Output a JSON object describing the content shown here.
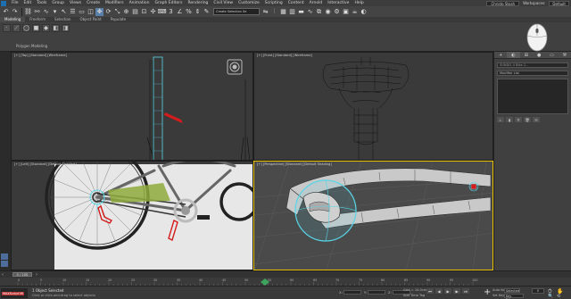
{
  "menu": {
    "items": [
      "File",
      "Edit",
      "Tools",
      "Group",
      "Views",
      "Create",
      "Modifiers",
      "Animation",
      "Graph Editors",
      "Rendering",
      "Civil View",
      "Customize",
      "Scripting",
      "Content",
      "Arnold",
      "Interactive",
      "Help"
    ],
    "user": "Christo Stosh",
    "workspaces_label": "Workspaces:",
    "workspace": "Default"
  },
  "toolbar": {
    "selection_set": "Create Selection Se"
  },
  "ribbon": {
    "tabs": [
      "Modeling",
      "Freeform",
      "Selection",
      "Object Paint",
      "Populate"
    ],
    "active_tab": "Modeling",
    "panel_label": "Polygon Modeling"
  },
  "viewports": {
    "top": "[+] [Top] [Standard] [Wireframe]",
    "front": "[+] [Front] [Standard] [Wireframe]",
    "left": "[+] [Left] [Standard] [Default Shading]",
    "perspective": "[+] [Perspective] [Standard] [Default Shading]"
  },
  "command_panel": {
    "object_name": "SUNDO-4 Bike 2...",
    "modifier_list": "Modifier List"
  },
  "timeline": {
    "slider": "0 / 100",
    "ticks": [
      "0",
      "5",
      "10",
      "15",
      "20",
      "25",
      "30",
      "35",
      "40",
      "45",
      "50",
      "55",
      "60",
      "65",
      "70",
      "75",
      "80",
      "85",
      "90",
      "95",
      "100"
    ]
  },
  "status": {
    "maxscript": "MAXScript Mi",
    "selected": "1 Object Selected",
    "prompt": "Click or click-and-drag to select objects",
    "x_label": "X:",
    "y_label": "Y:",
    "z_label": "Z:",
    "grid": "Grid = 10.0cm",
    "add_time_tag": "Add Time Tag",
    "autokey": "Auto Key",
    "selected_label": "Selected",
    "set_key": "Set Key",
    "key_filters": "Key Filters...",
    "frame": "0"
  },
  "colors": {
    "active_viewport_border": "#e8c200",
    "selection_cyan": "#58d6e8",
    "annotation_red": "#d41c1c",
    "ribbon_active": "#5a7fa8"
  }
}
